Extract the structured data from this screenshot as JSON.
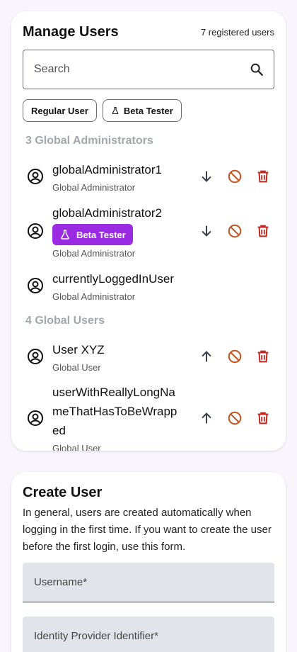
{
  "manage": {
    "title": "Manage Users",
    "count": "7 registered users",
    "search_placeholder": "Search",
    "filters": [
      {
        "label": "Regular User"
      },
      {
        "label": "Beta Tester"
      }
    ]
  },
  "admins": {
    "heading": "3 Global Administrators",
    "users": [
      {
        "name": "globalAdministrator1",
        "role": "Global Administrator"
      },
      {
        "name": "globalAdministrator2",
        "role": "Global Administrator",
        "badge": "Beta Tester"
      },
      {
        "name": "currentlyLoggedInUser",
        "role": "Global Administrator"
      }
    ]
  },
  "globals": {
    "heading": "4 Global Users",
    "users": [
      {
        "name": "User XYZ",
        "role": "Global User"
      },
      {
        "name": "userWithReallyLongNameThatHasToBeWrapped",
        "role": "Global User"
      }
    ]
  },
  "create": {
    "title": "Create User",
    "description": "In general, users are created automatically when logging in the first time. If you want to create the user before the first login, use this form.",
    "username_label": "Username*",
    "idp_label": "Identity Provider Identifier*"
  },
  "colors": {
    "badge": "#9a2be2",
    "ban_icon": "#c5521e",
    "delete_icon": "#c2261f",
    "section_heading": "#a3a6ad"
  }
}
